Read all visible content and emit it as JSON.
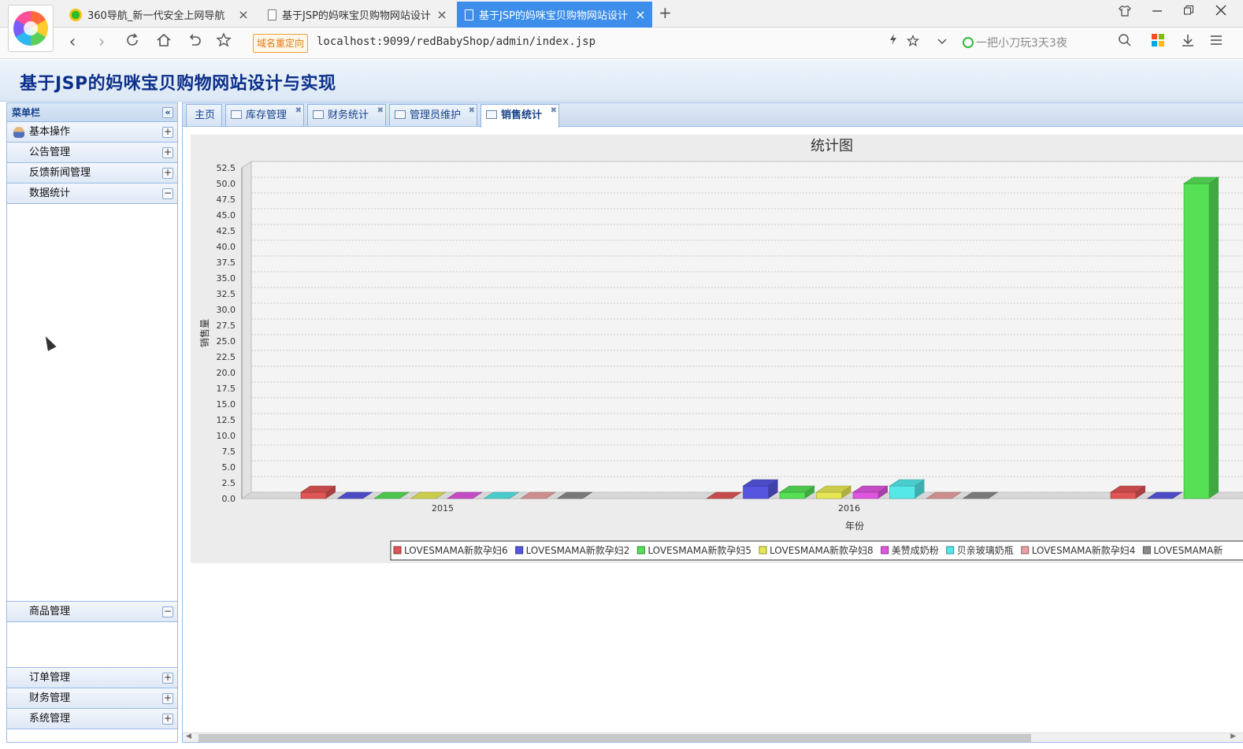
{
  "browser": {
    "tabs": [
      {
        "title": "360导航_新一代安全上网导航",
        "active": false,
        "icon": "360-icon"
      },
      {
        "title": "基于JSP的妈咪宝贝购物网站设计",
        "active": false,
        "icon": "document-icon"
      },
      {
        "title": "基于JSP的妈咪宝贝购物网站设计",
        "active": true,
        "icon": "document-icon"
      }
    ],
    "new_tab": "+",
    "redirect_badge": "域名重定向",
    "url": "localhost:9099/redBabyShop/admin/index.jsp",
    "search_placeholder": "一把小刀玩3天3夜"
  },
  "page": {
    "title": "基于JSP的妈咪宝贝购物网站设计与实现"
  },
  "sidebar": {
    "title": "菜单栏",
    "collapse": "«",
    "panels": [
      {
        "label": "基本操作",
        "toggle": "+"
      },
      {
        "label": "公告管理",
        "toggle": "+"
      },
      {
        "label": "反馈新闻管理",
        "toggle": "+"
      },
      {
        "label": "数据统计",
        "toggle": "−"
      },
      {
        "label": "商品管理",
        "toggle": "−"
      },
      {
        "label": "订单管理",
        "toggle": "+"
      },
      {
        "label": "财务管理",
        "toggle": "+"
      },
      {
        "label": "系统管理",
        "toggle": "+"
      }
    ]
  },
  "content_tabs": [
    {
      "label": "主页",
      "closable": false,
      "active": false
    },
    {
      "label": "库存管理",
      "closable": true,
      "active": false
    },
    {
      "label": "财务统计",
      "closable": true,
      "active": false
    },
    {
      "label": "管理员维护",
      "closable": true,
      "active": false
    },
    {
      "label": "销售统计",
      "closable": true,
      "active": true
    }
  ],
  "chart_data": {
    "type": "bar",
    "title": "统计图",
    "xlabel": "年份",
    "ylabel": "销售量",
    "ylim": [
      0,
      52.5
    ],
    "yticks": [
      "0.0",
      "2.5",
      "5.0",
      "7.5",
      "10.0",
      "12.5",
      "15.0",
      "17.5",
      "20.0",
      "22.5",
      "25.0",
      "27.5",
      "30.0",
      "32.5",
      "35.0",
      "37.5",
      "40.0",
      "42.5",
      "45.0",
      "47.5",
      "50.0",
      "52.5"
    ],
    "categories": [
      "2015",
      "2016",
      ""
    ],
    "series": [
      {
        "name": "LOVESMAMA新款孕妇6",
        "color": "#e05555",
        "values": [
          1,
          0,
          1
        ]
      },
      {
        "name": "LOVESMAMA新款孕妇2",
        "color": "#5555e0",
        "values": [
          0,
          2,
          0
        ]
      },
      {
        "name": "LOVESMAMA新款孕妇5",
        "color": "#55e055",
        "values": [
          0,
          1,
          50
        ]
      },
      {
        "name": "LOVESMAMA新款孕妇8",
        "color": "#e8e855",
        "values": [
          0,
          1,
          0
        ]
      },
      {
        "name": "美赞成奶粉",
        "color": "#e055e0",
        "values": [
          0,
          1,
          null
        ]
      },
      {
        "name": "贝亲玻璃奶瓶",
        "color": "#55e8e8",
        "values": [
          0,
          2,
          null
        ]
      },
      {
        "name": "LOVESMAMA新款孕妇4",
        "color": "#eaa0a0",
        "values": [
          0,
          0,
          null
        ]
      },
      {
        "name": "LOVESMAMA新",
        "color": "#8a8a8a",
        "values": [
          0,
          0,
          null
        ]
      }
    ],
    "grid": true,
    "legend": "bottom"
  }
}
